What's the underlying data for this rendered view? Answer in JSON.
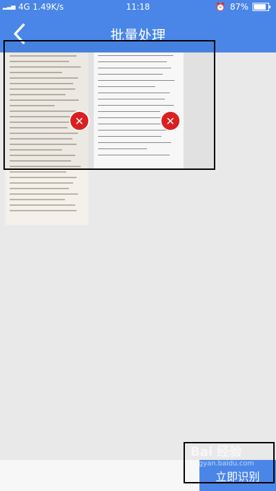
{
  "statusbar": {
    "network": "4G",
    "speed": "1.49K/s",
    "time": "11:18",
    "battery": "87%"
  },
  "header": {
    "title": "批量处理"
  },
  "bottom": {
    "recognize_label": "立即识别"
  },
  "watermark": {
    "line1": "Bai 经验",
    "line2": "jingyan.baidu.com"
  }
}
